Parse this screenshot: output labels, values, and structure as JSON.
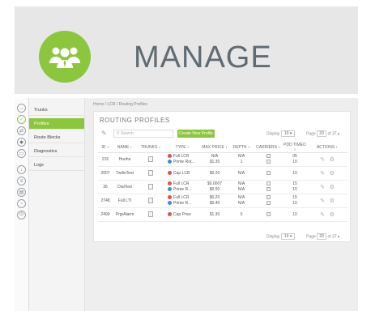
{
  "banner": {
    "title": "MANAGE",
    "icon": "users-icon",
    "accent": "#8cc63f"
  },
  "rail_icons": [
    "sign-in-icon",
    "circle-check-icon",
    "swap-icon",
    "shield-icon",
    "card-icon",
    "download-icon",
    "list-icon",
    "database-icon",
    "wave-icon",
    "power-icon"
  ],
  "nav": {
    "items": [
      {
        "label": "Trunks"
      },
      {
        "label": "Profiles"
      },
      {
        "label": "Route Blocks"
      },
      {
        "label": "Diagnostics"
      },
      {
        "label": "Logs"
      }
    ]
  },
  "breadcrumb": "Home / LCR / Routing Profiles",
  "panel": {
    "title": "ROUTING PROFILES",
    "search_placeholder": "Search",
    "new_button": "Create New Profile",
    "display_label": "Display",
    "display_value": "10",
    "page_label": "Page",
    "page_value": "20",
    "page_total": "of 37"
  },
  "columns": [
    "ID",
    "NAME",
    "TRUNKS",
    "TYPE",
    "MAX PRICE",
    "DEPTH",
    "CARRIERS",
    "PDD TIMEO",
    "ACTIONS"
  ],
  "rows": [
    {
      "id": "215",
      "name": "Hoohe",
      "types": [
        {
          "color": "#d9534f",
          "label": "Full LCR"
        },
        {
          "color": "#3a8fd8",
          "label": "Prime Rot..."
        }
      ],
      "prices": [
        "N/A",
        "$1.30"
      ],
      "depths": [
        "N/A",
        "1"
      ],
      "pdd": [
        "05",
        "10"
      ]
    },
    {
      "id": "2007",
      "name": "TwilioTest",
      "types": [
        {
          "color": "#d9534f",
          "label": "Cap LCR"
        }
      ],
      "prices": [
        "$0.20"
      ],
      "depths": [
        "N/A"
      ],
      "pdd": [
        "10"
      ]
    },
    {
      "id": "36",
      "name": "DialTest",
      "types": [
        {
          "color": "#d9534f",
          "label": "Full LCR"
        },
        {
          "color": "#3a8fd8",
          "label": "Prime R..."
        }
      ],
      "prices": [
        "$0.0007",
        "$0.50"
      ],
      "depths": [
        "N/A",
        "N/A"
      ],
      "pdd": [
        "15",
        "10"
      ]
    },
    {
      "id": "2748",
      "name": "Full LTI",
      "types": [
        {
          "color": "#d9534f",
          "label": "Full LCR"
        },
        {
          "color": "#3a8fd8",
          "label": "Prime R..."
        }
      ],
      "prices": [
        "$0.20",
        "$0.40"
      ],
      "depths": [
        "N/A",
        "N/A"
      ],
      "pdd": [
        "15",
        "10"
      ]
    },
    {
      "id": "2499",
      "name": "PrgrAlarm",
      "types": [
        {
          "color": "#d9534f",
          "label": "Cap Price"
        }
      ],
      "prices": [
        "$1.30"
      ],
      "depths": [
        "0"
      ],
      "pdd": [
        "10"
      ]
    }
  ]
}
